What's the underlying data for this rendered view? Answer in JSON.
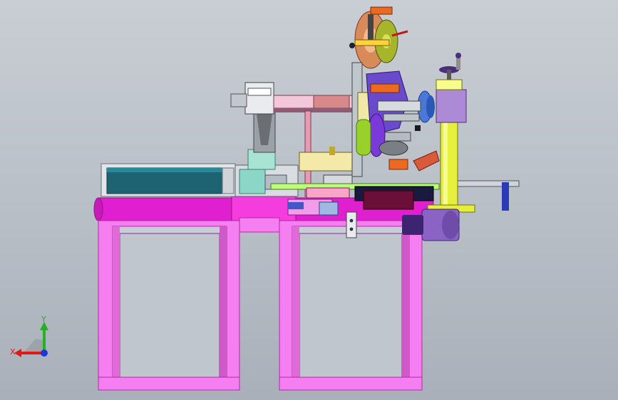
{
  "viewport": {
    "background_top": "#c9ced4",
    "background_bottom": "#a9b0b9"
  },
  "model": {
    "frame_color": "#f57ef0",
    "frame_edge": "#b12aa6",
    "tube_color": "#e01fd0",
    "column_color": "#e6f03c",
    "tank_color": "#1d6372",
    "wheel_color": "#d88a5a",
    "motor_color": "#8a63c4"
  },
  "triad": {
    "x_label": "X",
    "y_label": "Y",
    "x_color": "#e01818",
    "y_color": "#22b222",
    "z_color": "#1a3ad6"
  }
}
